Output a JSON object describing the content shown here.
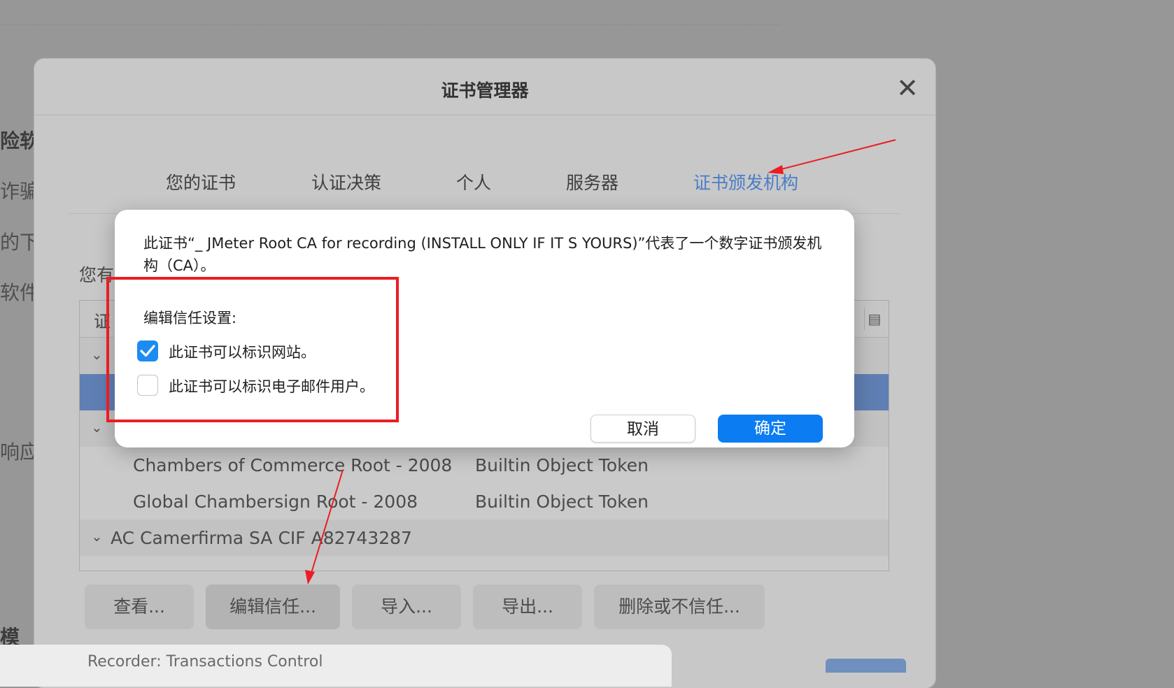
{
  "background": {
    "fragments": [
      "险软",
      "诈骗",
      "的下",
      "软件",
      "响应",
      "模"
    ]
  },
  "manager": {
    "title": "证书管理器",
    "close_glyph": "✕",
    "tabs": [
      {
        "label": "您的证书"
      },
      {
        "label": "认证决策"
      },
      {
        "label": "个人"
      },
      {
        "label": "服务器"
      },
      {
        "label": "证书颁发机构"
      }
    ],
    "description_partial": "您有",
    "tree": {
      "column_header_partial": "证",
      "rows": [
        {
          "name": "Chambers of Commerce Root - 2008",
          "device": "Builtin Object Token"
        },
        {
          "name": "Global Chambersign Root - 2008",
          "device": "Builtin Object Token"
        },
        {
          "group": "AC Camerfirma SA CIF A82743287"
        }
      ]
    },
    "buttons": {
      "view": "查看...",
      "edit_trust": "编辑信任...",
      "import": "导入...",
      "export": "导出...",
      "delete": "删除或不信任..."
    }
  },
  "bottom_window": {
    "title": "Recorder: Transactions Control"
  },
  "modal": {
    "message": "此证书“_ JMeter Root CA for recording (INSTALL ONLY IF IT S YOURS)”代表了一个数字证书颁发机构（CA）。",
    "label": "编辑信任设置:",
    "checkbox_website": {
      "label": "此证书可以标识网站。",
      "checked": true
    },
    "checkbox_email": {
      "label": "此证书可以标识电子邮件用户。",
      "checked": false
    },
    "cancel": "取消",
    "ok": "确定"
  },
  "colors": {
    "accent": "#0b7cf2",
    "active_tab": "#4a7dc7",
    "annotation": "#ec1c24"
  }
}
